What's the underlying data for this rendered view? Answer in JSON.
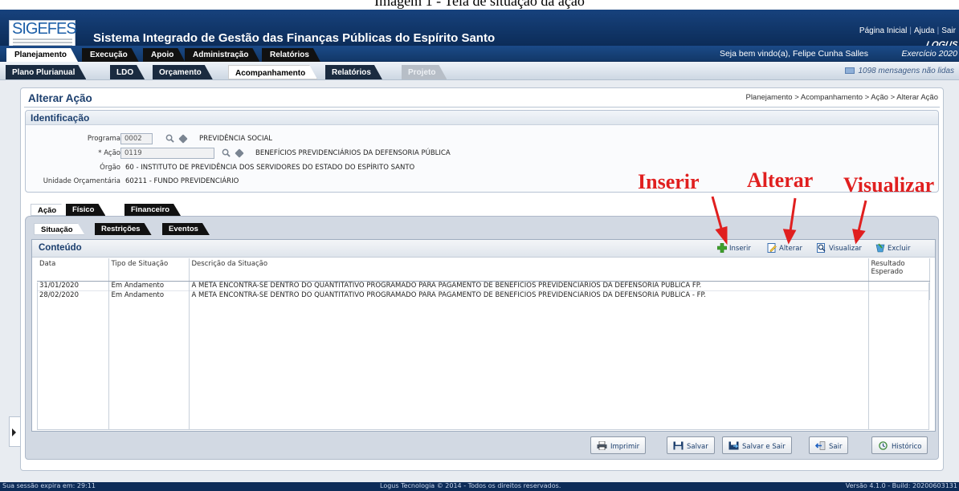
{
  "document_caption": "Imagem 1 - Tela de situação da ação",
  "header": {
    "logo_text": "SIGEFES",
    "app_title": "Sistema Integrado de Gestão das Finanças Públicas do Espírito Santo",
    "top_links": [
      "Página Inicial",
      "Ajuda",
      "Sair"
    ],
    "brand": "LOGUS",
    "welcome": "Seja bem vindo(a), Felipe Cunha Salles",
    "exercise": "Exercício 2020"
  },
  "main_tabs": [
    {
      "label": "Planejamento",
      "active": true
    },
    {
      "label": "Execução"
    },
    {
      "label": "Apoio"
    },
    {
      "label": "Administração"
    },
    {
      "label": "Relatórios"
    }
  ],
  "sub_tabs": [
    {
      "label": "Plano Plurianual"
    },
    {
      "label": "LDO"
    },
    {
      "label": "Orçamento"
    },
    {
      "label": "Acompanhamento",
      "active": true
    },
    {
      "label": "Relatórios"
    },
    {
      "label": "Projeto",
      "disabled": true
    }
  ],
  "messages": "1098 mensagens não lidas",
  "page": {
    "title": "Alterar Ação",
    "breadcrumb": "Planejamento > Acompanhamento > Ação > Alterar Ação"
  },
  "identification": {
    "title": "Identificação",
    "programa_label": "Programa",
    "programa_value": "0002",
    "programa_desc": "PREVIDÊNCIA SOCIAL",
    "acao_label": "* Ação",
    "acao_value": "0119",
    "acao_desc": "BENEFÍCIOS PREVIDENCIÁRIOS DA DEFENSORIA PÚBLICA",
    "orgao_label": "Órgão",
    "orgao_value": "60 - INSTITUTO DE PREVIDÊNCIA DOS SERVIDORES DO ESTADO DO ESPÍRITO SANTO",
    "unidade_label": "Unidade Orçamentária",
    "unidade_value": "60211 - FUNDO PREVIDENCIÁRIO"
  },
  "section_tabs": [
    {
      "label": "Ação",
      "active": true
    },
    {
      "label": "Físico"
    },
    {
      "label": "Financeiro"
    }
  ],
  "detail_tabs": [
    {
      "label": "Situação",
      "active": true
    },
    {
      "label": "Restrições"
    },
    {
      "label": "Eventos"
    }
  ],
  "content": {
    "title": "Conteúdo",
    "actions": [
      "Inserir",
      "Alterar",
      "Visualizar",
      "Excluir"
    ]
  },
  "grid": {
    "headers": [
      "Data",
      "Tipo de Situação",
      "Descrição da Situação",
      "Resultado Esperado"
    ],
    "rows": [
      [
        "31/01/2020",
        "Em Andamento",
        "A META ENCONTRA-SE DENTRO DO QUANTITATIVO PROGRAMADO PARA PAGAMENTO DE BENEFÍCIOS PREVIDENCIÁRIOS DA DEFENSORIA PÚBLICA FP.",
        ""
      ],
      [
        "28/02/2020",
        "Em Andamento",
        "A META ENCONTRA-SE DENTRO DO QUANTITATIVO PROGRAMADO PARA PAGAMENTO DE BENEFÍCIOS PREVIDENCIÁRIOS DA DEFENSORIA PÚBLICA - FP.",
        ""
      ]
    ]
  },
  "footer_buttons": [
    "Imprimir",
    "Salvar",
    "Salvar e Sair",
    "Sair",
    "Histórico"
  ],
  "statusbar": {
    "session": "Sua sessão expira em: 29:11",
    "copyright": "Logus Tecnologia © 2014 - Todos os direitos reservados.",
    "version": "Versão 4.1.0 - Build: 20200603131"
  },
  "annotations": [
    "Inserir",
    "Alterar",
    "Visualizar"
  ],
  "colors": {
    "header_bg": "#0c2c58",
    "accent": "#1c3f6e",
    "annotation": "#e01f1f"
  }
}
